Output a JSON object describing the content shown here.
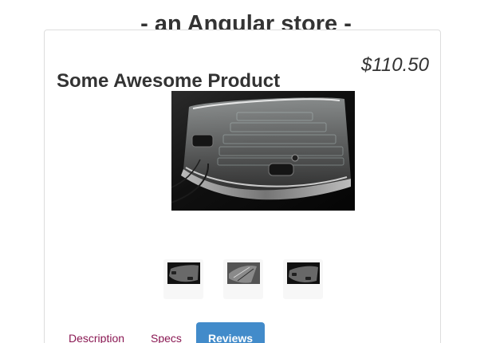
{
  "store": {
    "title": "- an Angular store -"
  },
  "product": {
    "name": "Some Awesome Product",
    "price": "$110.50"
  },
  "gallery": {
    "main_image": "glass-keyboard-photo",
    "thumbnails": [
      "glass-keyboard-thumbnail",
      "glass-device-thumbnail",
      "glass-keyboard-thumbnail"
    ]
  },
  "tabs": [
    {
      "label": "Description",
      "active": false
    },
    {
      "label": "Specs",
      "active": false
    },
    {
      "label": "Reviews",
      "active": true
    }
  ],
  "colors": {
    "tab_text": "#8a1853",
    "active_tab": "#428bca",
    "panel_border": "#dddddd"
  }
}
